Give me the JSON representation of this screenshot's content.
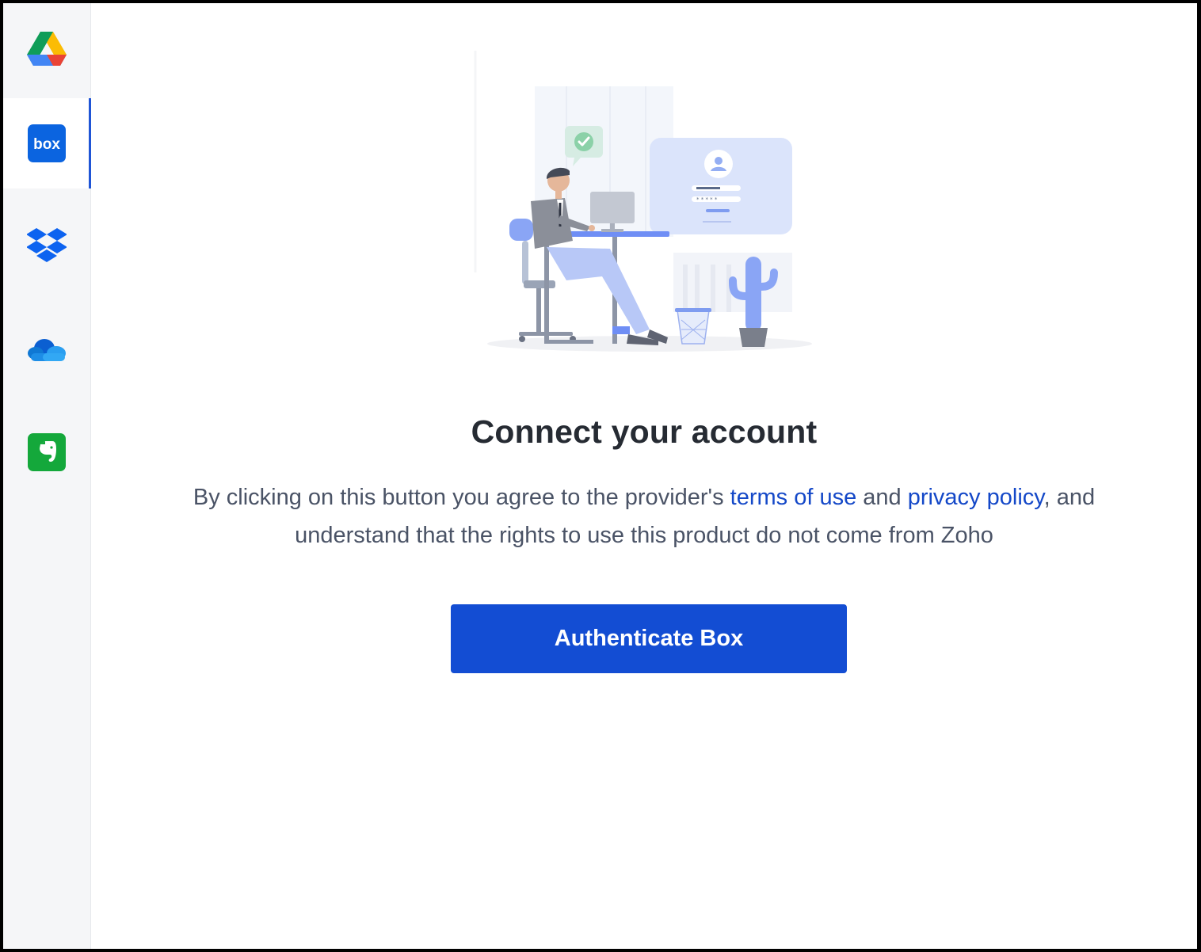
{
  "sidebar": {
    "items": [
      {
        "name": "google-drive",
        "icon": "google-drive-icon",
        "active": false
      },
      {
        "name": "box",
        "icon": "box-icon",
        "label": "box",
        "active": true
      },
      {
        "name": "dropbox",
        "icon": "dropbox-icon",
        "active": false
      },
      {
        "name": "onedrive",
        "icon": "onedrive-icon",
        "active": false
      },
      {
        "name": "evernote",
        "icon": "evernote-icon",
        "active": false
      }
    ]
  },
  "main": {
    "title": "Connect your account",
    "description": {
      "part1": "By clicking on this button you agree to the provider's ",
      "terms_link": "terms of use",
      "part2": " and ",
      "privacy_link": "privacy policy",
      "part3": ", and understand that the rights to use this product do not come from Zoho"
    },
    "button_label": "Authenticate Box"
  },
  "colors": {
    "accent": "#134dd3",
    "link": "#1448c8",
    "sidebar_bg": "#f5f6f8"
  }
}
